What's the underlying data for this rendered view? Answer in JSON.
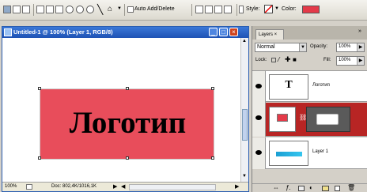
{
  "options_bar": {
    "auto_add_delete_label": "Auto Add/Delete",
    "style_label": "Style:",
    "color_label": "Color:",
    "color_value": "#e43a49",
    "icons": [
      "path-combine-icon",
      "shape-pen-icon",
      "freeform-pen-icon",
      "rectangle-icon",
      "rounded-rectangle-icon",
      "ellipse-icon",
      "polygon-icon",
      "line-icon",
      "custom-shape-icon"
    ]
  },
  "document": {
    "title": "Untitled-1 @ 100% (Layer 1, RGB/8)",
    "zoom": "100%",
    "doc_info": "Doc: 802,4K/1016,1K",
    "logo_text": "Логотип",
    "logo_color": "#e84d5b"
  },
  "layers_panel": {
    "tab_label": "Layers ×",
    "blend_mode": "Normal",
    "opacity_label": "Opacity:",
    "opacity_value": "100%",
    "lock_label": "Lock:",
    "fill_label": "Fill:",
    "fill_value": "100%",
    "layers": [
      {
        "name": "Логотип",
        "type": "text",
        "thumb_glyph": "T"
      },
      {
        "name": "",
        "type": "shape",
        "selected": true
      },
      {
        "name": "Layer 1",
        "type": "raster"
      }
    ],
    "footer_icons": [
      "link-icon",
      "fx-icon",
      "mask-icon",
      "adjustment-icon",
      "folder-icon",
      "new-layer-icon",
      "trash-icon"
    ]
  }
}
